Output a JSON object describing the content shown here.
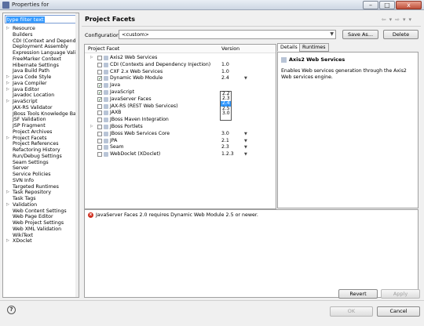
{
  "window": {
    "title": "Properties for",
    "controls": {
      "minimize": "–",
      "maximize": "□",
      "close": "x"
    }
  },
  "filter": {
    "value": "type filter text"
  },
  "tree": [
    {
      "label": "Resource",
      "expandable": true
    },
    {
      "label": "Builders"
    },
    {
      "label": "CDI (Context and Dependen"
    },
    {
      "label": "Deployment Assembly"
    },
    {
      "label": "Expression Language Valida"
    },
    {
      "label": "FreeMarker Context"
    },
    {
      "label": "Hibernate Settings"
    },
    {
      "label": "Java Build Path"
    },
    {
      "label": "Java Code Style",
      "expandable": true
    },
    {
      "label": "Java Compiler",
      "expandable": true
    },
    {
      "label": "Java Editor",
      "expandable": true
    },
    {
      "label": "Javadoc Location"
    },
    {
      "label": "JavaScript",
      "expandable": true
    },
    {
      "label": "JAX-RS Validator"
    },
    {
      "label": "JBoss Tools Knowledge Bas"
    },
    {
      "label": "JSF Validation"
    },
    {
      "label": "JSP Fragment"
    },
    {
      "label": "Project Archives"
    },
    {
      "label": "Project Facets",
      "expandable": true,
      "selected": true
    },
    {
      "label": "Project References"
    },
    {
      "label": "Refactoring History"
    },
    {
      "label": "Run/Debug Settings"
    },
    {
      "label": "Seam Settings"
    },
    {
      "label": "Server"
    },
    {
      "label": "Service Policies"
    },
    {
      "label": "SVN Info"
    },
    {
      "label": "Targeted Runtimes"
    },
    {
      "label": "Task Repository",
      "expandable": true
    },
    {
      "label": "Task Tags"
    },
    {
      "label": "Validation",
      "expandable": true
    },
    {
      "label": "Web Content Settings"
    },
    {
      "label": "Web Page Editor"
    },
    {
      "label": "Web Project Settings"
    },
    {
      "label": "Web XML Validation"
    },
    {
      "label": "WikiText"
    },
    {
      "label": "XDoclet",
      "expandable": true
    }
  ],
  "page": {
    "title": "Project Facets",
    "configuration_label": "Configuration:",
    "configuration_value": "<custom>",
    "save_as": "Save As...",
    "delete": "Delete"
  },
  "facets": {
    "columns": [
      "Project Facet",
      "Version"
    ],
    "rows": [
      {
        "expand": true,
        "checked": false,
        "name": "Axis2 Web Services",
        "version": ""
      },
      {
        "expand": false,
        "checked": false,
        "name": "CDI (Contexts and Dependency Injection)",
        "version": "1.0"
      },
      {
        "expand": false,
        "checked": false,
        "name": "CXF 2.x Web Services",
        "version": "1.0"
      },
      {
        "expand": false,
        "checked": true,
        "name": "Dynamic Web Module",
        "version": "2.4",
        "dropdown": true
      },
      {
        "expand": false,
        "checked": true,
        "name": "Java",
        "version": ""
      },
      {
        "expand": false,
        "checked": true,
        "name": "JavaScript",
        "version": ""
      },
      {
        "expand": false,
        "checked": true,
        "name": "JavaServer Faces",
        "version": ""
      },
      {
        "expand": false,
        "checked": false,
        "name": "JAX-RS (REST Web Services)",
        "version": ""
      },
      {
        "expand": false,
        "checked": false,
        "name": "JAXB",
        "version": "2.2"
      },
      {
        "expand": false,
        "checked": false,
        "name": "JBoss Maven Integration",
        "version": "1.0"
      },
      {
        "expand": true,
        "checked": false,
        "name": "JBoss Portlets",
        "version": ""
      },
      {
        "expand": false,
        "checked": false,
        "name": "JBoss Web Services Core",
        "version": "3.0",
        "dropdown": true
      },
      {
        "expand": false,
        "checked": false,
        "name": "JPA",
        "version": "2.1",
        "dropdown": true
      },
      {
        "expand": false,
        "checked": false,
        "name": "Seam",
        "version": "2.3",
        "dropdown": true
      },
      {
        "expand": false,
        "checked": false,
        "name": "WebDoclet (XDoclet)",
        "version": "1.2.3",
        "dropdown": true
      }
    ],
    "version_options": [
      "2.2",
      "2.3",
      "2.4",
      "2.5",
      "3.0"
    ],
    "version_selected": "2.4"
  },
  "details": {
    "tabs": [
      "Details",
      "Runtimes"
    ],
    "title": "Axis2 Web Services",
    "description": "Enables Web services generation through the Axis2 Web services engine."
  },
  "problem": {
    "message": "JavaServer Faces 2.0 requires Dynamic Web Module 2.5 or newer."
  },
  "buttons": {
    "revert": "Revert",
    "apply": "Apply",
    "ok": "OK",
    "cancel": "Cancel",
    "help": "?"
  }
}
